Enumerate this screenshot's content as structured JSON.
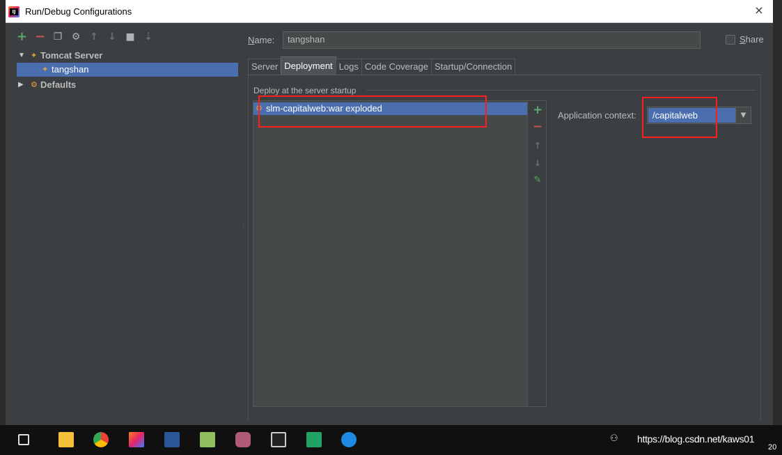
{
  "window": {
    "title": "Run/Debug Configurations",
    "close_glyph": "×"
  },
  "toolbar": {
    "buttons": [
      {
        "name": "add",
        "glyph": "+"
      },
      {
        "name": "remove",
        "glyph": "−"
      },
      {
        "name": "copy",
        "glyph": "❐"
      },
      {
        "name": "edit-defaults",
        "glyph": "⚙"
      },
      {
        "name": "move-up",
        "glyph": "↑"
      },
      {
        "name": "move-down",
        "glyph": "↓"
      },
      {
        "name": "folder",
        "glyph": "■"
      },
      {
        "name": "sort",
        "glyph": "⇣"
      }
    ]
  },
  "tree": {
    "tomcat_group": "Tomcat Server",
    "tomcat_child": "tangshan",
    "defaults": "Defaults",
    "expanded_arrow": "▼",
    "collapsed_arrow": "▶"
  },
  "form": {
    "name_label_first": "N",
    "name_label_rest": "ame:",
    "name_value": "tangshan",
    "share_label_first": "S",
    "share_label_rest": "hare"
  },
  "tabs": [
    {
      "label": "Server",
      "active": false
    },
    {
      "label": "Deployment",
      "active": true
    },
    {
      "label": "Logs",
      "active": false
    },
    {
      "label": "Code Coverage",
      "active": false
    },
    {
      "label": "Startup/Connection",
      "active": false
    }
  ],
  "deployment": {
    "section_title": "Deploy at the server startup",
    "artifact": "slm-capitalweb:war exploded",
    "side_buttons": {
      "add": "+",
      "remove": "−",
      "up": "↑",
      "down": "↓",
      "edit": "✎"
    },
    "context_label": "Application context:",
    "context_value": "/capitalweb",
    "context_arrow": "▼"
  },
  "taskbar": {
    "tray_icon": "person-icon",
    "watermark": "https://blog.csdn.net/kaws01",
    "watermark_suffix": "20"
  },
  "colors": {
    "accent_selection": "#4b6eaf",
    "annotation_red": "#ff1e1e",
    "add_green": "#59a869",
    "remove_red": "#c75450"
  }
}
